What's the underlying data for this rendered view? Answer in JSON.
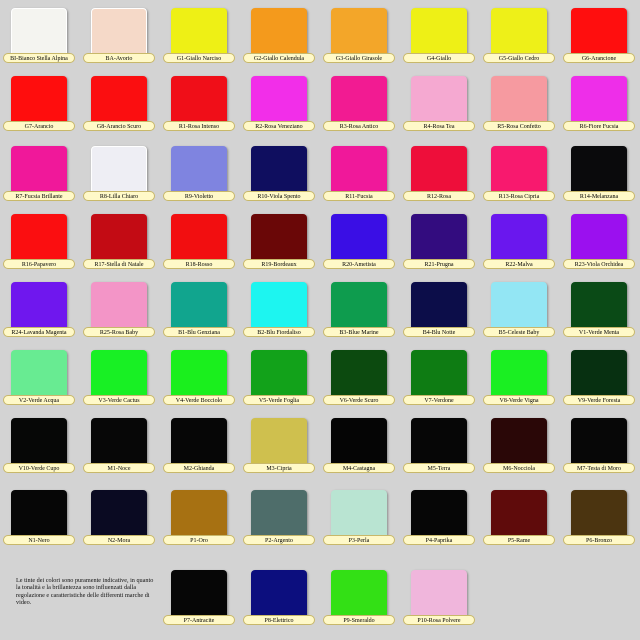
{
  "swatches": [
    {
      "label": "BI-Bianco Stella Alpina",
      "color": "#f4f4f0"
    },
    {
      "label": "BA-Avorio",
      "color": "#f5d9c8"
    },
    {
      "label": "G1-Giallo Narciso",
      "color": "#eef015"
    },
    {
      "label": "G2-Giallo Calendula",
      "color": "#f49a1c"
    },
    {
      "label": "G3-Giallo Girasole",
      "color": "#f3a629"
    },
    {
      "label": "G4-Giallo",
      "color": "#eef016"
    },
    {
      "label": "G5-Giallo Cedro",
      "color": "#eef018"
    },
    {
      "label": "G6-Arancione",
      "color": "#ff0e0e"
    },
    {
      "label": "G7-Arancio",
      "color": "#ff0d0d"
    },
    {
      "label": "G8-Arancio Scuro",
      "color": "#fb0e10"
    },
    {
      "label": "R1-Rosa Intenso",
      "color": "#f00e18"
    },
    {
      "label": "R2-Rosa Veneziano",
      "color": "#f22ee9"
    },
    {
      "label": "R3-Rosa Antico",
      "color": "#f21b92"
    },
    {
      "label": "R4-Rosa Tea",
      "color": "#f5a9d1"
    },
    {
      "label": "R5-Rosa Confetto",
      "color": "#f69aa0"
    },
    {
      "label": "R6-Fiore Fucsia",
      "color": "#ee2ee9"
    },
    {
      "label": "R7-Fucsia Brillante",
      "color": "#f0189a"
    },
    {
      "label": "R8-Lilla Chiaro",
      "color": "#eeeef4"
    },
    {
      "label": "R9-Violetto",
      "color": "#7f84e0"
    },
    {
      "label": "R10-Viola Spento",
      "color": "#0f0e5f"
    },
    {
      "label": "R11-Fucsia",
      "color": "#f0189a"
    },
    {
      "label": "R12-Rosa",
      "color": "#ee0e3a"
    },
    {
      "label": "R13-Rosa Cipria",
      "color": "#f8196e"
    },
    {
      "label": "R14-Melanzana",
      "color": "#0a0a0c"
    },
    {
      "label": "R16-Papavero",
      "color": "#fb0e10"
    },
    {
      "label": "R17-Stella di Natale",
      "color": "#c30b14"
    },
    {
      "label": "R18-Rosso",
      "color": "#f20e10"
    },
    {
      "label": "R19-Bordeaux",
      "color": "#6a0707"
    },
    {
      "label": "R20-Ametista",
      "color": "#3a0ee5"
    },
    {
      "label": "R21-Prugna",
      "color": "#330c7f"
    },
    {
      "label": "R22-Malva",
      "color": "#6a17ee"
    },
    {
      "label": "R23-Viola Orchidea",
      "color": "#9b10ef"
    },
    {
      "label": "R24-Lavanda Magenta",
      "color": "#6f17ee"
    },
    {
      "label": "R25-Rosa Baby",
      "color": "#f395c7"
    },
    {
      "label": "B1-Blu Genziana",
      "color": "#11a58e"
    },
    {
      "label": "B2-Blu Fiordaliso",
      "color": "#1df5f0"
    },
    {
      "label": "B3-Blue Marine",
      "color": "#0e9c4e"
    },
    {
      "label": "B4-Blu Notte",
      "color": "#0c0d49"
    },
    {
      "label": "B5-Celeste Baby",
      "color": "#93e6f4"
    },
    {
      "label": "V1-Verde Menta",
      "color": "#0a4a16"
    },
    {
      "label": "V2-Verde Acqua",
      "color": "#68eb92"
    },
    {
      "label": "V3-Verde Cactus",
      "color": "#18f024"
    },
    {
      "label": "V4-Verde Bocciolo",
      "color": "#1aef1d"
    },
    {
      "label": "V5-Verde Foglia",
      "color": "#12a21a"
    },
    {
      "label": "V6-Verde Scuro",
      "color": "#0c4a0f"
    },
    {
      "label": "V7-Verdone",
      "color": "#0e7c13"
    },
    {
      "label": "V8-Verde Vigna",
      "color": "#1aef22"
    },
    {
      "label": "V9-Verde Foresta",
      "color": "#073011"
    },
    {
      "label": "V10-Verde Cupo",
      "color": "#060706"
    },
    {
      "label": "M1-Noce",
      "color": "#070707"
    },
    {
      "label": "M2-Ghianda",
      "color": "#060606"
    },
    {
      "label": "M3-Cipria",
      "color": "#cfc04e"
    },
    {
      "label": "M4-Castagna",
      "color": "#050505"
    },
    {
      "label": "M5-Terra",
      "color": "#060606"
    },
    {
      "label": "M6-Nocciola",
      "color": "#2a0707"
    },
    {
      "label": "M7-Testa di Moro",
      "color": "#070707"
    },
    {
      "label": "N1-Nero",
      "color": "#060606"
    },
    {
      "label": "N2-Mora",
      "color": "#0a0a22"
    },
    {
      "label": "P1-Oro",
      "color": "#a77112"
    },
    {
      "label": "P2-Argento",
      "color": "#4e6d6a"
    },
    {
      "label": "P3-Perla",
      "color": "#b9e4d2"
    },
    {
      "label": "P4-Paprika",
      "color": "#060606"
    },
    {
      "label": "P5-Rame",
      "color": "#5f0b0b"
    },
    {
      "label": "P6-Bronzo",
      "color": "#4b3410"
    },
    {
      "label": "P7-Antracite",
      "color": "#060606"
    },
    {
      "label": "P8-Elettrico",
      "color": "#0c0e7e"
    },
    {
      "label": "P9-Smeraldo",
      "color": "#33e015"
    },
    {
      "label": "P10-Rosa Polvere",
      "color": "#f0b6dc"
    }
  ],
  "note": "Le tinte dei colori sono puramente indicative, in quanto la tonalità e la brillantezza sono influenzati dalla regolazione e caratteristiche delle differenti marche di video."
}
